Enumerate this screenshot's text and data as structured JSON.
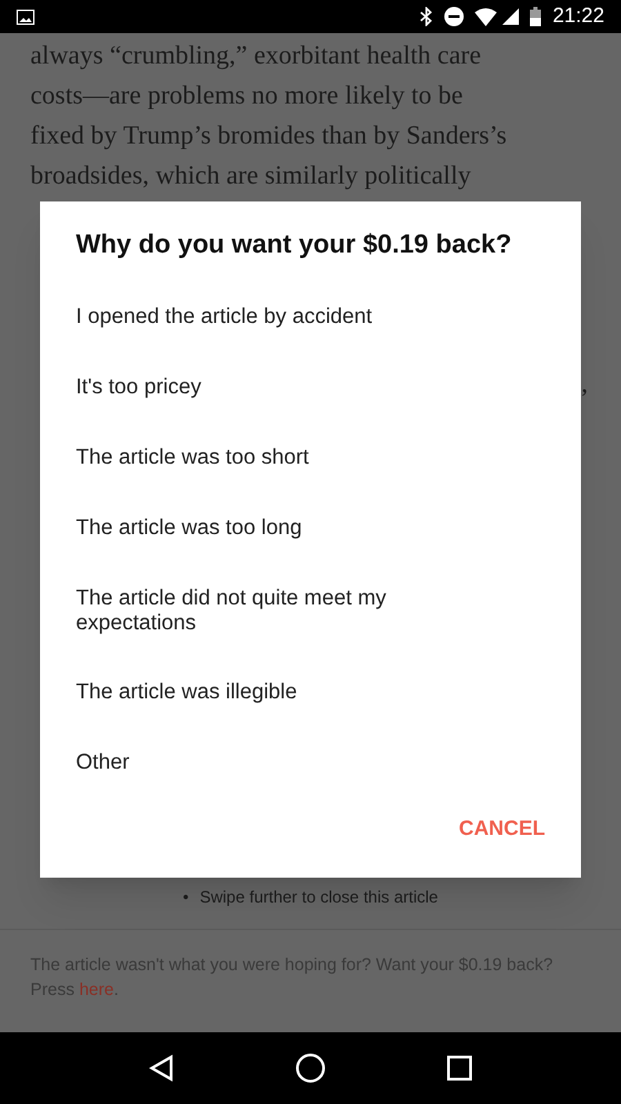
{
  "status_bar": {
    "time": "21:22"
  },
  "article": {
    "lines": [
      "always “crumbling,” exorbitant health care",
      "costs—are problems no more likely to be",
      "fixed by Trump’s bromides than by Sanders’s",
      "broadsides, which are similarly politically"
    ],
    "comma_fragment": ",",
    "swipe_bullet": "•",
    "swipe_hint": "Swipe further to close this article"
  },
  "footer": {
    "text": "The article wasn't what you were hoping for? Want your $0.19 back? Press ",
    "link": "here",
    "end": "."
  },
  "dialog": {
    "title": "Why do you want your $0.19 back?",
    "options": [
      "I opened the article by accident",
      "It's too pricey",
      "The article was too short",
      "The article was too long",
      "The article did not quite meet my expectations",
      "The article was illegible",
      "Other"
    ],
    "cancel": "CANCEL"
  }
}
